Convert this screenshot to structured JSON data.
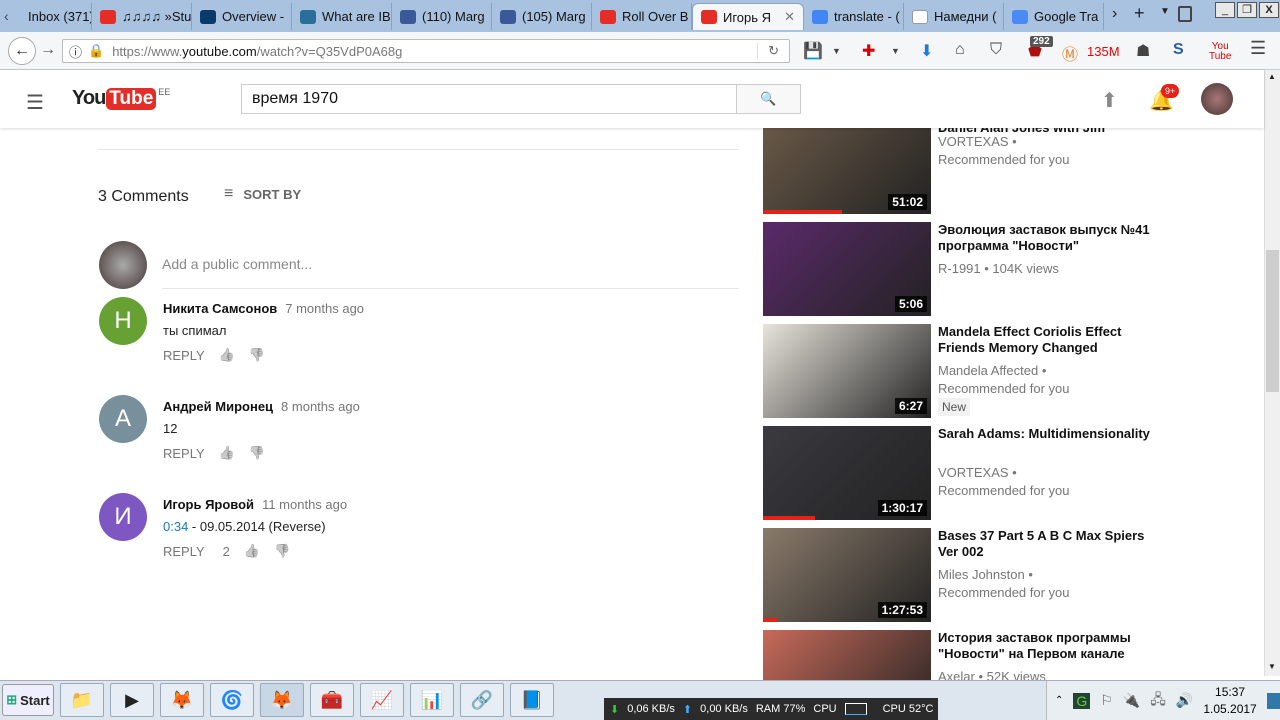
{
  "browser": {
    "tabs": [
      {
        "label": "Inbox (371)",
        "icon": "mail-icon",
        "color": "#a8c2df"
      },
      {
        "label": "♫♫♫♫ »Stu",
        "icon": "youtube-icon",
        "color": "#e52d27"
      },
      {
        "label": "Overview -",
        "icon": "page-icon",
        "color": "#0a3a6a"
      },
      {
        "label": "What are IB",
        "icon": "de-icon",
        "color": "#2a6f9a"
      },
      {
        "label": "(110) Marg",
        "icon": "facebook-icon",
        "color": "#3b5998"
      },
      {
        "label": "(105) Marg",
        "icon": "facebook-icon",
        "color": "#3b5998"
      },
      {
        "label": "Roll Over B",
        "icon": "youtube-icon",
        "color": "#e52d27"
      },
      {
        "label": "Игорь Я",
        "icon": "youtube-icon",
        "color": "#e52d27",
        "active": true
      },
      {
        "label": "translate - (",
        "icon": "google-icon",
        "color": "#4285f4"
      },
      {
        "label": "Намедни (",
        "icon": "wikipedia-icon",
        "color": "#ffffff"
      },
      {
        "label": "Google Tra",
        "icon": "google-translate-icon",
        "color": "#4a8af4"
      }
    ],
    "url_prefix": "https://www.",
    "url_domain": "youtube.com",
    "url_path": "/watch?v=Q35VdP0A68g",
    "addon_badge": "292",
    "memory": "135M"
  },
  "youtube": {
    "logo_region": "EE",
    "search_value": "время 1970",
    "notifications": "9+",
    "comments": {
      "count_label": "3 Comments",
      "sort_label": "SORT BY",
      "placeholder": "Add a public comment...",
      "reply_label": "REPLY",
      "items": [
        {
          "initial": "Н",
          "color": "#67a033",
          "author": "Никита Самсонов",
          "time": "7 months ago",
          "text": "ты спимал",
          "likes": ""
        },
        {
          "initial": "А",
          "color": "#78909c",
          "author": "Андрей Миронец",
          "time": "8 months ago",
          "text": "12",
          "likes": ""
        },
        {
          "initial": "И",
          "color": "#7e57c2",
          "author": "Игорь Яровой",
          "time": "11 months ago",
          "timestamp_link": "0:34",
          "text": " - 09.05.2014 (Reverse)",
          "likes": "2"
        }
      ]
    },
    "videos": [
      {
        "title": "Daniel Alan Jones with Jim",
        "channel": "VORTEXAS •",
        "meta": "Recommended for you",
        "duration": "51:02",
        "progress": 0.47,
        "thumb": "#6b5a48"
      },
      {
        "title": "Эволюция заставок выпуск №41 программа \"Новости\"",
        "channel": "R-1991 • 104K views",
        "meta": "",
        "duration": "5:06",
        "progress": 0,
        "thumb": "#5a2a6a"
      },
      {
        "title": "Mandela Effect Coriolis Effect Friends Memory Changed",
        "channel": "Mandela Affected •",
        "meta": "Recommended for you",
        "badge": "New",
        "duration": "6:27",
        "progress": 0,
        "thumb": "#e8e4dc"
      },
      {
        "title": "Sarah Adams: Multidimensionality",
        "channel": "VORTEXAS •",
        "meta": "Recommended for you",
        "duration": "1:30:17",
        "progress": 0.31,
        "thumb": "#3a3a40"
      },
      {
        "title": "Bases 37 Part 5 A B C Max Spiers Ver 002",
        "channel": "Miles Johnston •",
        "meta": "Recommended for you",
        "duration": "1:27:53",
        "progress": 0.09,
        "thumb": "#8a7a6a"
      },
      {
        "title": "История заставок программы \"Новости\" на Первом канале",
        "channel": "Axelar • 52K views",
        "meta": "",
        "duration": "",
        "progress": 0,
        "thumb": "#c86a5a"
      }
    ]
  },
  "taskbar": {
    "start_label": "Start",
    "net_down": "0,06 KB/s",
    "net_up": "0,00 KB/s",
    "ram": "RAM 77%",
    "cpu_label": "CPU",
    "cpu_temp": "CPU 52°C",
    "time": "15:37",
    "date": "1.05.2017"
  }
}
